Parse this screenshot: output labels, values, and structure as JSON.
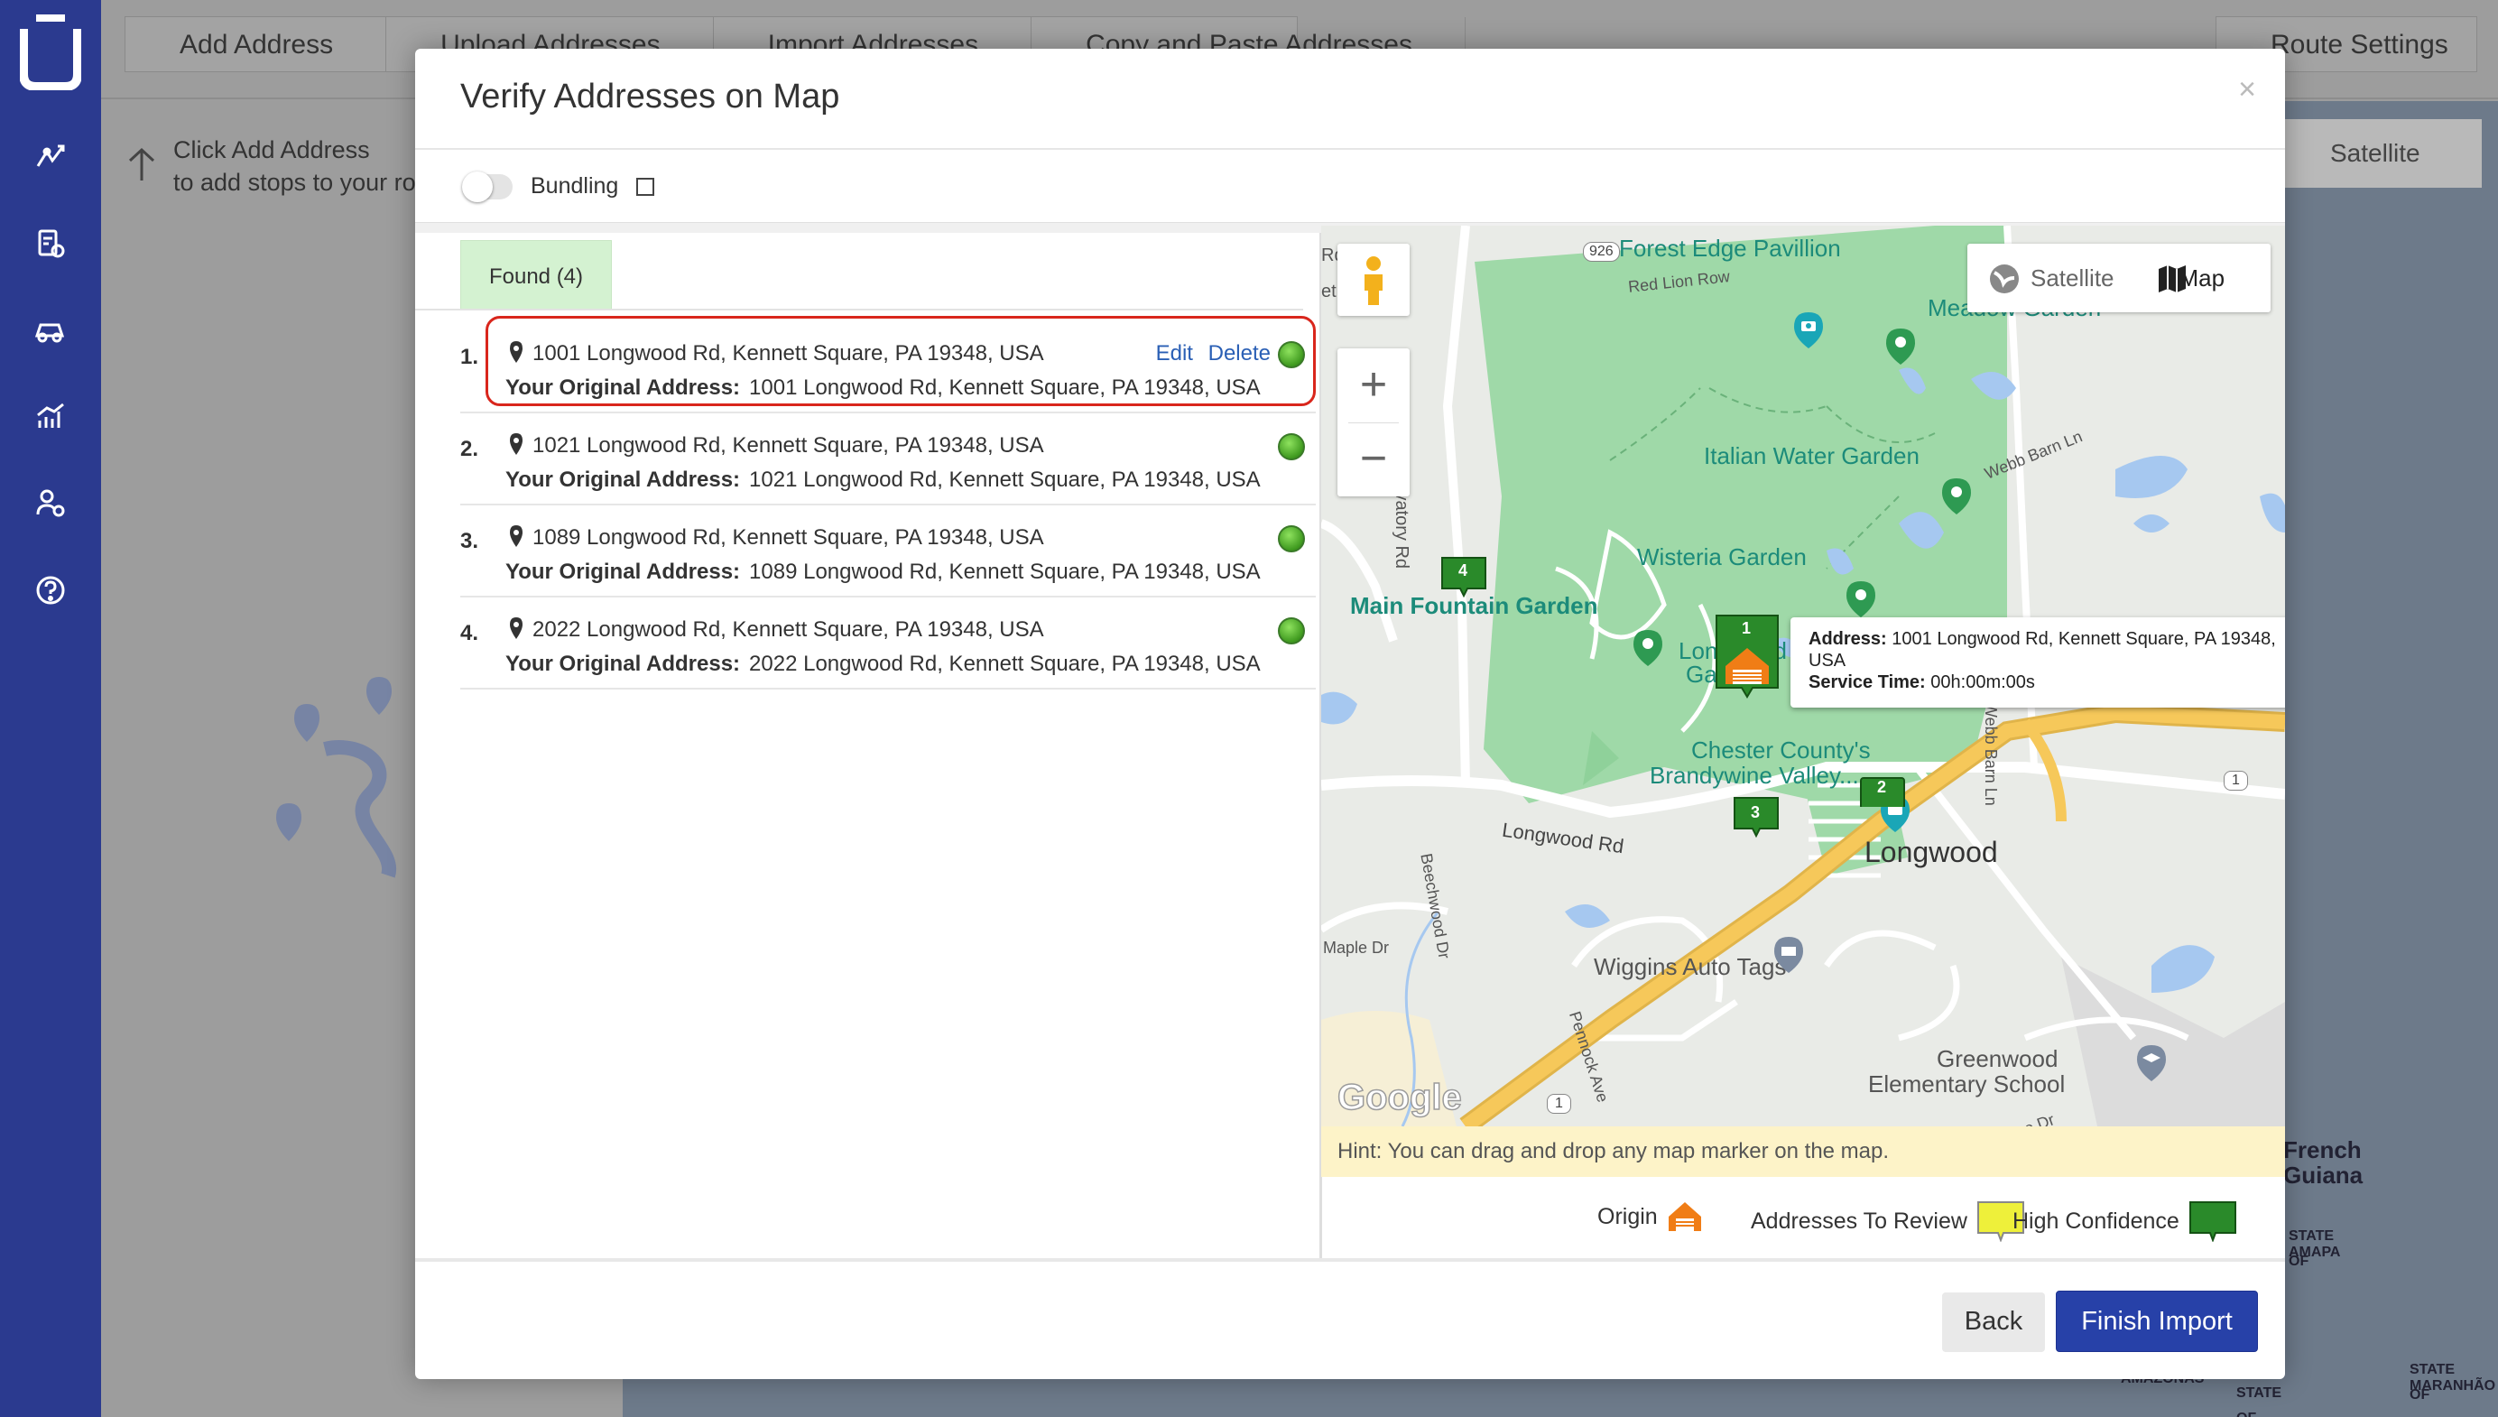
{
  "background": {
    "toolbar": [
      "Add Address",
      "Upload Addresses",
      "Import Addresses",
      "Copy and Paste Addresses"
    ],
    "route_settings": "Route Settings",
    "hint_line1": "Click Add Address",
    "hint_line2": "to add stops to your ro",
    "map_satellite": "Satellite",
    "geo_labels": [
      "French",
      "Guiana",
      "STATE OF",
      "AMAPA",
      "AMAZONAS",
      "STATE OF PARA",
      "STATE OF",
      "MARANHÃO"
    ]
  },
  "sidebar": {
    "icons": [
      "route-icon",
      "tasks-icon",
      "driver-icon",
      "analytics-icon",
      "user-settings-icon",
      "help-icon"
    ]
  },
  "modal": {
    "title": "Verify Addresses on Map",
    "close": "×",
    "bundling_label": "Bundling",
    "found_tab": "Found (4)",
    "edit_label": "Edit",
    "delete_label": "Delete",
    "original_label": "Your Original Address:",
    "addresses": [
      {
        "num": "1.",
        "address": "1001 Longwood Rd, Kennett Square, PA 19348, USA",
        "original": "1001 Longwood Rd, Kennett Square, PA 19348, USA"
      },
      {
        "num": "2.",
        "address": "1021 Longwood Rd, Kennett Square, PA 19348, USA",
        "original": "1021 Longwood Rd, Kennett Square, PA 19348, USA"
      },
      {
        "num": "3.",
        "address": "1089 Longwood Rd, Kennett Square, PA 19348, USA",
        "original": "1089 Longwood Rd, Kennett Square, PA 19348, USA"
      },
      {
        "num": "4.",
        "address": "2022 Longwood Rd, Kennett Square, PA 19348, USA",
        "original": "2022 Longwood Rd, Kennett Square, PA 19348, USA"
      }
    ],
    "hint": "Hint: You can drag and drop any map marker on the map.",
    "legend": {
      "origin": "Origin",
      "review": "Addresses To Review",
      "high": "High Confidence"
    },
    "back": "Back",
    "finish": "Finish Import"
  },
  "map": {
    "satellite": "Satellite",
    "map": "Map",
    "zoom_in": "+",
    "zoom_out": "−",
    "google": "Google",
    "tooltip": {
      "address_label": "Address:",
      "address_value": "1001 Longwood Rd, Kennett Square, PA 19348,",
      "address_cont": "USA",
      "service_label": "Service Time:",
      "service_value": "00h:00m:00s"
    },
    "markers": [
      "1",
      "2",
      "3",
      "4"
    ],
    "places": {
      "forest_edge": "Forest Edge Pavillion",
      "meadow": "Meadow Garden",
      "italian": "Italian Water Garden",
      "wisteria": "Wisteria Garden",
      "main_fountain": "Main Fountain Garden",
      "longwood_gardens_1": "Longwood",
      "longwood_gardens_2": "Gardens",
      "chester_1": "Chester County's",
      "chester_2": "Brandywine Valley...",
      "longwood": "Longwood",
      "wiggins": "Wiggins Auto Tags",
      "greenwood_1": "Greenwood",
      "greenwood_2": "Elementary School"
    },
    "roads": {
      "red_lion": "Red Lion Row",
      "conservatory": "Conservatory Rd",
      "webb_barn": "Webb Barn Ln",
      "webb_barn_2": "Webb Barn Ln",
      "longwood_rd": "Longwood Rd",
      "beechwood": "Beechwood Dr",
      "maple": "Maple Dr",
      "pennock": "Pennock Ave",
      "pierre": "Pierre Dr",
      "shield_926": "926",
      "shield_1a": "1",
      "shield_1b": "1",
      "edge_rd": "Rd",
      "edge_et": "et"
    }
  }
}
